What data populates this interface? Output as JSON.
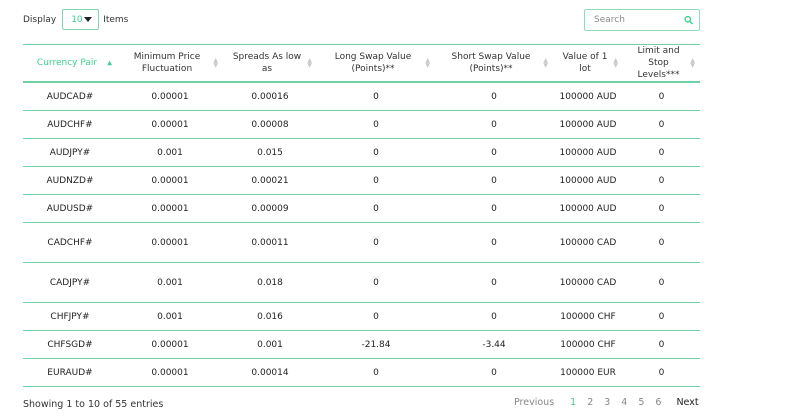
{
  "controls": {
    "display_label": "Display",
    "display_value": "10",
    "items_label": "Items",
    "search_placeholder": "Search"
  },
  "table": {
    "columns": [
      "Currency Pair",
      "Minimum Price Fluctuation",
      "Spreads As low as",
      "Long Swap Value (Points)**",
      "Short Swap Value (Points)**",
      "Value of 1 lot",
      "Limit and Stop Levels***"
    ],
    "rows": [
      [
        "AUDCAD#",
        "0.00001",
        "0.00016",
        "0",
        "0",
        "100000 AUD",
        "0"
      ],
      [
        "AUDCHF#",
        "0.00001",
        "0.00008",
        "0",
        "0",
        "100000 AUD",
        "0"
      ],
      [
        "AUDJPY#",
        "0.001",
        "0.015",
        "0",
        "0",
        "100000 AUD",
        "0"
      ],
      [
        "AUDNZD#",
        "0.00001",
        "0.00021",
        "0",
        "0",
        "100000 AUD",
        "0"
      ],
      [
        "AUDUSD#",
        "0.00001",
        "0.00009",
        "0",
        "0",
        "100000 AUD",
        "0"
      ],
      [
        "CADCHF#",
        "0.00001",
        "0.00011",
        "0",
        "0",
        "100000 CAD",
        "0"
      ],
      [
        "CADJPY#",
        "0.001",
        "0.018",
        "0",
        "0",
        "100000 CAD",
        "0"
      ],
      [
        "CHFJPY#",
        "0.001",
        "0.016",
        "0",
        "0",
        "100000 CHF",
        "0"
      ],
      [
        "CHFSGD#",
        "0.00001",
        "0.001",
        "-21.84",
        "-3.44",
        "100000 CHF",
        "0"
      ],
      [
        "EURAUD#",
        "0.00001",
        "0.00014",
        "0",
        "0",
        "100000 EUR",
        "0"
      ]
    ]
  },
  "footer": {
    "entries_info": "Showing 1 to 10 of 55 entries",
    "previous_label": "Previous",
    "pages": [
      "1",
      "2",
      "3",
      "4",
      "5",
      "6"
    ],
    "current_page": "1",
    "next_label": "Next"
  },
  "colors": {
    "accent": "#3ecf8e",
    "border": "#6fd0a3"
  },
  "icons": {
    "search": "search-icon",
    "dropdown": "chevron-down-icon",
    "sort": "sort-icon"
  }
}
